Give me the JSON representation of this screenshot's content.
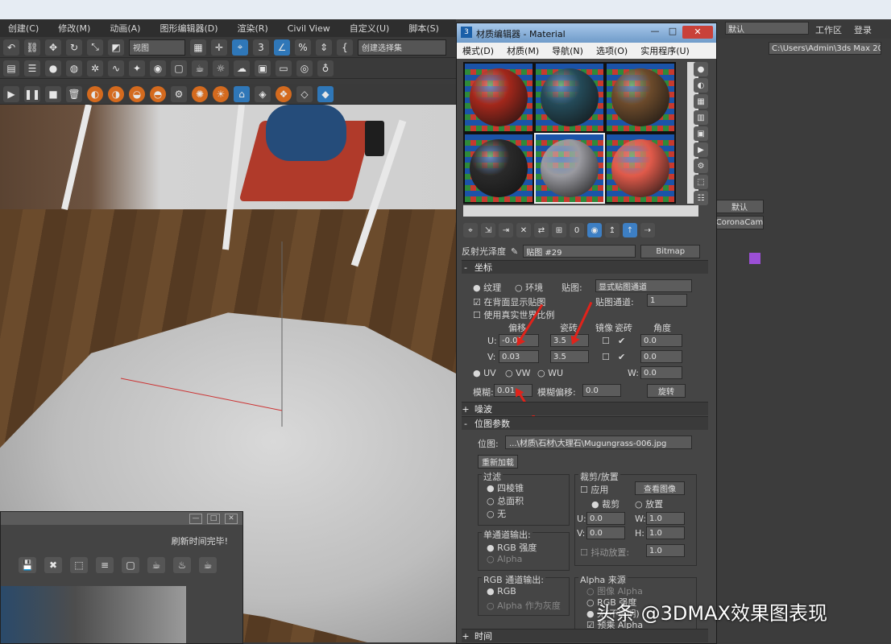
{
  "app": {
    "menu": [
      "创建(C)",
      "修改(M)",
      "动画(A)",
      "图形编辑器(D)",
      "渲染(R)",
      "Civil View",
      "自定义(U)",
      "脚本(S)"
    ],
    "toolbar": {
      "view_select": "视图",
      "create_selection_label": "创建选择集"
    },
    "right_top": {
      "workspace_label": "工作区",
      "workspace_value": "默认",
      "login_label": "登录"
    },
    "right_panel": {
      "path": "C:\\Users\\Admin\\3ds Max 2020",
      "field_a": "默认",
      "field_b": "CoronaCam",
      "swatch_color": "#9b4fd6"
    }
  },
  "preview_window": {
    "status_text": "刷新时间完毕!"
  },
  "material_editor": {
    "title": "材质编辑器 - Material",
    "menu": [
      "模式(D)",
      "材质(M)",
      "导航(N)",
      "选项(O)",
      "实用程序(U)"
    ],
    "slot_colors": [
      "#a2271b",
      "#244a58",
      "#6b4a2b",
      "#2a2a2a",
      "#9a9aa0",
      "#e05a4a"
    ],
    "reflection_label": "反射光泽度",
    "map_name_value": "贴图 #29",
    "map_type_button": "Bitmap",
    "coords": {
      "header": "坐标",
      "texture_radio": "纹理",
      "environ_radio": "环境",
      "mapping_label": "贴图:",
      "mapping_value": "显式贴图通道",
      "use_real_world": "在背面显示贴图",
      "use_real_world_scale": "使用真实世界比例",
      "map_channel_label": "贴图通道:",
      "map_channel_value": "1",
      "col_offset": "偏移",
      "col_tiling": "瓷砖",
      "col_mirror": "镜像",
      "col_tile": "瓷砖",
      "col_angle": "角度",
      "u_label": "U:",
      "v_label": "V:",
      "w_label": "W:",
      "u_offset": "-0.08",
      "u_tiling": "3.5",
      "v_offset": "0.03",
      "v_tiling": "3.5",
      "u_angle": "0.0",
      "v_angle": "0.0",
      "w_angle": "0.0",
      "uv": "UV",
      "vw": "VW",
      "wu": "WU",
      "blur_label": "模糊:",
      "blur_value": "0.01",
      "blur_offset_label": "模糊偏移:",
      "blur_offset_value": "0.0",
      "rotate_button": "旋转"
    },
    "noise": {
      "header": "噪波"
    },
    "bitmap_params": {
      "header": "位图参数",
      "bitmap_label": "位图:",
      "bitmap_path": "...\\材质\\石材\\大理石\\Mugungrass-006.jpg",
      "reload_button": "重新加载",
      "crop_header": "裁剪/放置",
      "apply_label": "应用",
      "view_image_button": "查看图像",
      "crop_radio": "裁剪",
      "place_radio": "放置",
      "u_label": "U:",
      "u_value": "0.0",
      "w_label": "W:",
      "w_value": "1.0",
      "v_label": "V:",
      "v_value": "0.0",
      "h_label": "H:",
      "h_value": "1.0",
      "jitter_label": "抖动放置:",
      "jitter_value": "1.0",
      "filter_header": "过滤",
      "filter_pyramid": "四棱锥",
      "filter_summed": "总面积",
      "filter_none": "无",
      "mono_header": "单通道输出:",
      "mono_rgb": "RGB 强度",
      "mono_alpha": "Alpha",
      "rgb_header": "RGB 通道输出:",
      "rgb_rgb": "RGB",
      "rgb_alpha": "Alpha 作为灰度",
      "alpha_header": "Alpha 来源",
      "alpha_image": "图像 Alpha",
      "alpha_rgb": "RGB 强度",
      "alpha_none": "无(不透明)",
      "premult": "预乘 Alpha"
    },
    "time": {
      "header": "时间"
    }
  },
  "watermark": "头条 @3DMAX效果图表现"
}
